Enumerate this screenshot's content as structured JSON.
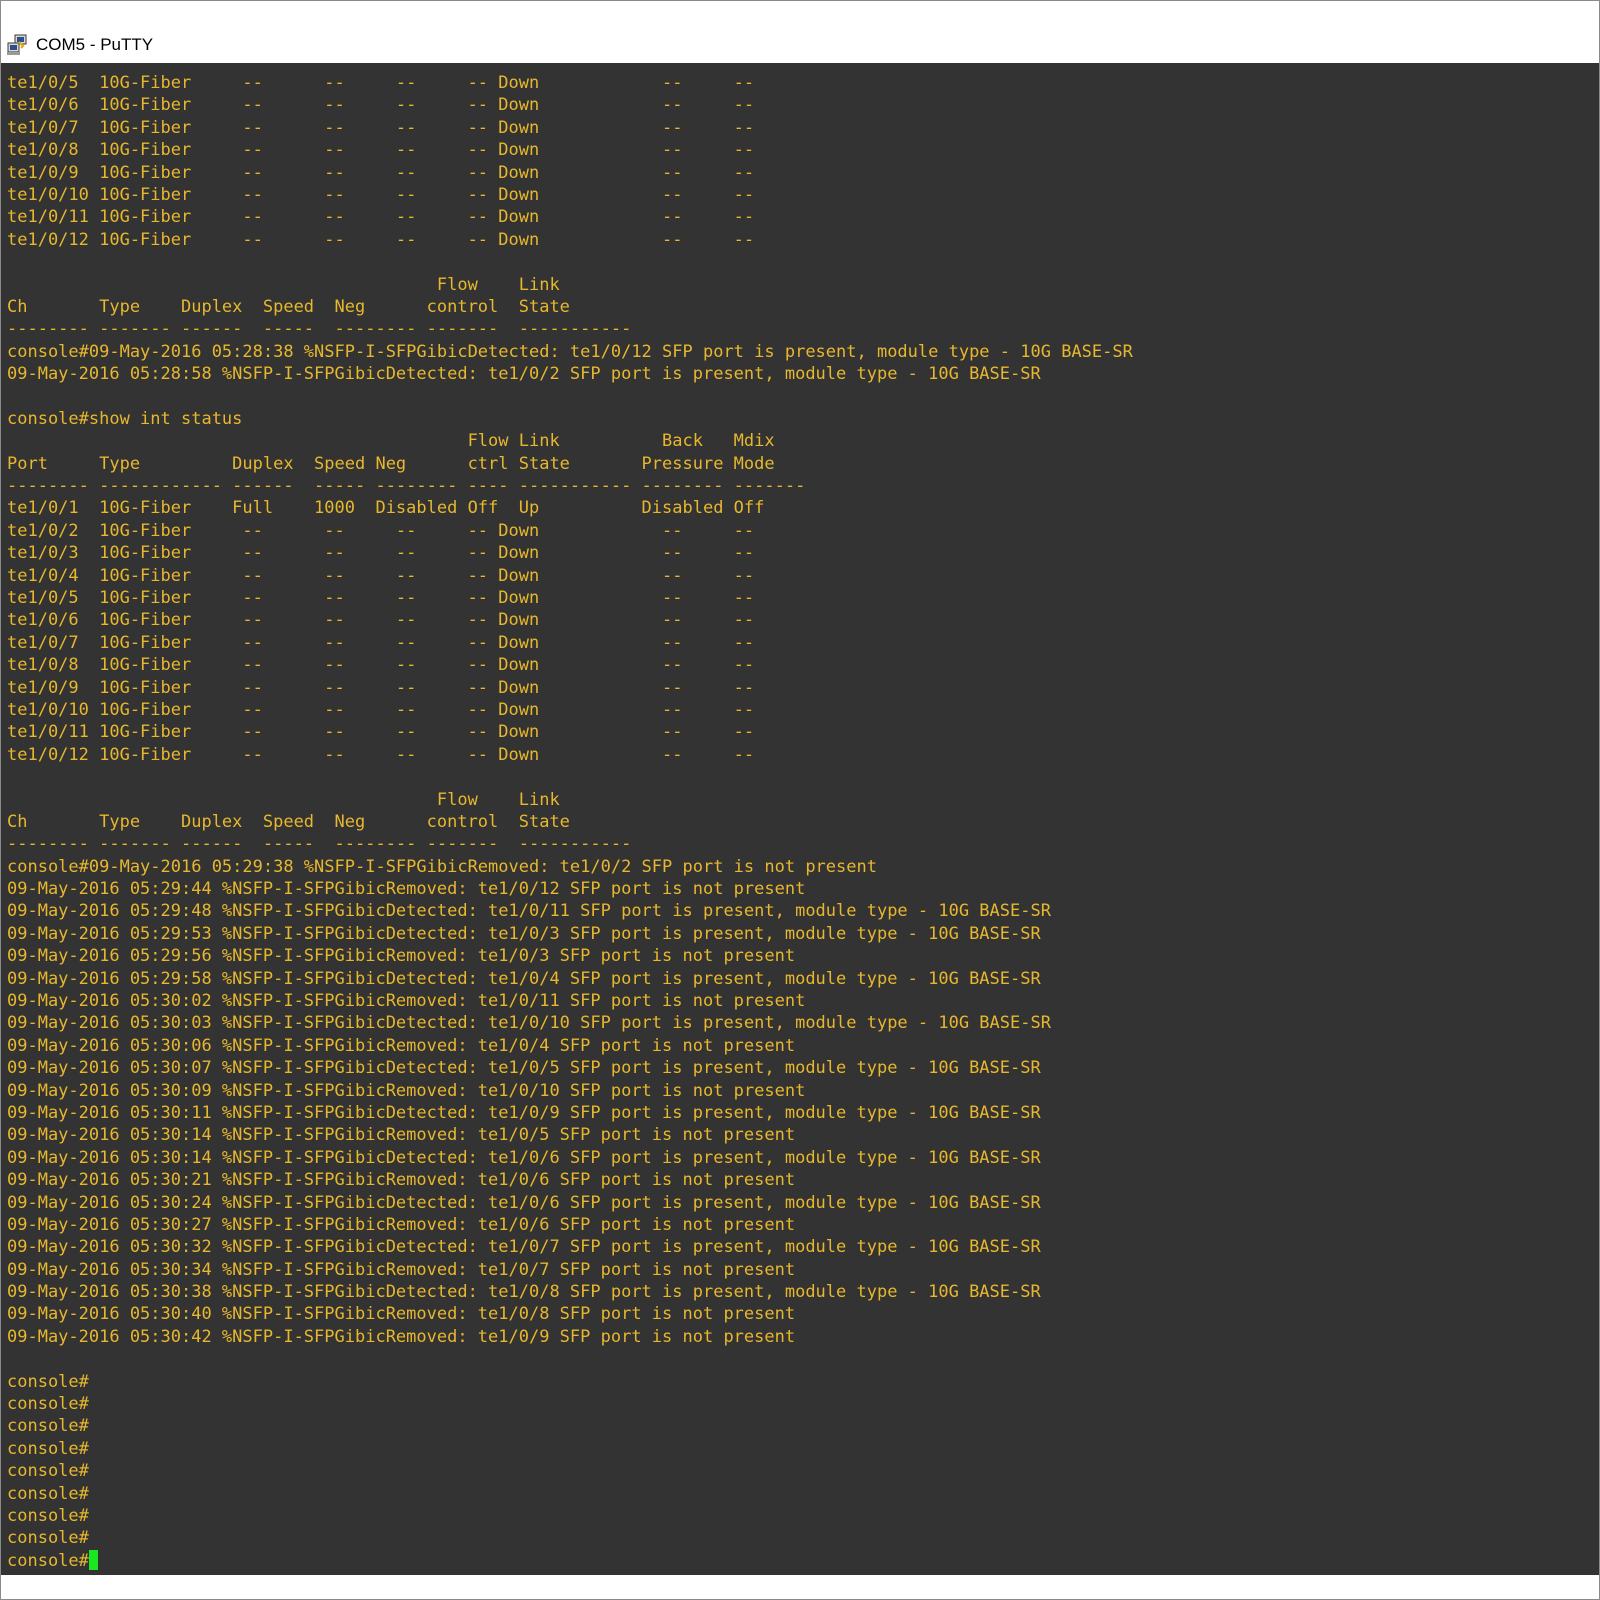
{
  "window": {
    "title": "COM5 - PuTTY",
    "app_icon": "putty-icon"
  },
  "colors": {
    "terminal_background": "#333333",
    "terminal_text": "#e7b72e",
    "cursor": "#19e81f",
    "titlebar": "#ffffff"
  },
  "terminal": {
    "lines": [
      "te1/0/5  10G-Fiber     --      --     --     -- Down            --     --",
      "te1/0/6  10G-Fiber     --      --     --     -- Down            --     --",
      "te1/0/7  10G-Fiber     --      --     --     -- Down            --     --",
      "te1/0/8  10G-Fiber     --      --     --     -- Down            --     --",
      "te1/0/9  10G-Fiber     --      --     --     -- Down            --     --",
      "te1/0/10 10G-Fiber     --      --     --     -- Down            --     --",
      "te1/0/11 10G-Fiber     --      --     --     -- Down            --     --",
      "te1/0/12 10G-Fiber     --      --     --     -- Down            --     --",
      "",
      "                                          Flow    Link",
      "Ch       Type    Duplex  Speed  Neg      control  State",
      "-------- ------- ------  -----  -------- -------  -----------",
      "console#09-May-2016 05:28:38 %NSFP-I-SFPGibicDetected: te1/0/12 SFP port is present, module type - 10G BASE-SR",
      "09-May-2016 05:28:58 %NSFP-I-SFPGibicDetected: te1/0/2 SFP port is present, module type - 10G BASE-SR",
      "",
      "console#show int status",
      "                                             Flow Link          Back   Mdix",
      "Port     Type         Duplex  Speed Neg      ctrl State       Pressure Mode",
      "-------- ------------ ------  ----- -------- ---- ----------- -------- -------",
      "te1/0/1  10G-Fiber    Full    1000  Disabled Off  Up          Disabled Off",
      "te1/0/2  10G-Fiber     --      --     --     -- Down            --     --",
      "te1/0/3  10G-Fiber     --      --     --     -- Down            --     --",
      "te1/0/4  10G-Fiber     --      --     --     -- Down            --     --",
      "te1/0/5  10G-Fiber     --      --     --     -- Down            --     --",
      "te1/0/6  10G-Fiber     --      --     --     -- Down            --     --",
      "te1/0/7  10G-Fiber     --      --     --     -- Down            --     --",
      "te1/0/8  10G-Fiber     --      --     --     -- Down            --     --",
      "te1/0/9  10G-Fiber     --      --     --     -- Down            --     --",
      "te1/0/10 10G-Fiber     --      --     --     -- Down            --     --",
      "te1/0/11 10G-Fiber     --      --     --     -- Down            --     --",
      "te1/0/12 10G-Fiber     --      --     --     -- Down            --     --",
      "",
      "                                          Flow    Link",
      "Ch       Type    Duplex  Speed  Neg      control  State",
      "-------- ------- ------  -----  -------- -------  -----------",
      "console#09-May-2016 05:29:38 %NSFP-I-SFPGibicRemoved: te1/0/2 SFP port is not present",
      "09-May-2016 05:29:44 %NSFP-I-SFPGibicRemoved: te1/0/12 SFP port is not present",
      "09-May-2016 05:29:48 %NSFP-I-SFPGibicDetected: te1/0/11 SFP port is present, module type - 10G BASE-SR",
      "09-May-2016 05:29:53 %NSFP-I-SFPGibicDetected: te1/0/3 SFP port is present, module type - 10G BASE-SR",
      "09-May-2016 05:29:56 %NSFP-I-SFPGibicRemoved: te1/0/3 SFP port is not present",
      "09-May-2016 05:29:58 %NSFP-I-SFPGibicDetected: te1/0/4 SFP port is present, module type - 10G BASE-SR",
      "09-May-2016 05:30:02 %NSFP-I-SFPGibicRemoved: te1/0/11 SFP port is not present",
      "09-May-2016 05:30:03 %NSFP-I-SFPGibicDetected: te1/0/10 SFP port is present, module type - 10G BASE-SR",
      "09-May-2016 05:30:06 %NSFP-I-SFPGibicRemoved: te1/0/4 SFP port is not present",
      "09-May-2016 05:30:07 %NSFP-I-SFPGibicDetected: te1/0/5 SFP port is present, module type - 10G BASE-SR",
      "09-May-2016 05:30:09 %NSFP-I-SFPGibicRemoved: te1/0/10 SFP port is not present",
      "09-May-2016 05:30:11 %NSFP-I-SFPGibicDetected: te1/0/9 SFP port is present, module type - 10G BASE-SR",
      "09-May-2016 05:30:14 %NSFP-I-SFPGibicRemoved: te1/0/5 SFP port is not present",
      "09-May-2016 05:30:14 %NSFP-I-SFPGibicDetected: te1/0/6 SFP port is present, module type - 10G BASE-SR",
      "09-May-2016 05:30:21 %NSFP-I-SFPGibicRemoved: te1/0/6 SFP port is not present",
      "09-May-2016 05:30:24 %NSFP-I-SFPGibicDetected: te1/0/6 SFP port is present, module type - 10G BASE-SR",
      "09-May-2016 05:30:27 %NSFP-I-SFPGibicRemoved: te1/0/6 SFP port is not present",
      "09-May-2016 05:30:32 %NSFP-I-SFPGibicDetected: te1/0/7 SFP port is present, module type - 10G BASE-SR",
      "09-May-2016 05:30:34 %NSFP-I-SFPGibicRemoved: te1/0/7 SFP port is not present",
      "09-May-2016 05:30:38 %NSFP-I-SFPGibicDetected: te1/0/8 SFP port is present, module type - 10G BASE-SR",
      "09-May-2016 05:30:40 %NSFP-I-SFPGibicRemoved: te1/0/8 SFP port is not present",
      "09-May-2016 05:30:42 %NSFP-I-SFPGibicRemoved: te1/0/9 SFP port is not present",
      "",
      "console#",
      "console#",
      "console#",
      "console#",
      "console#",
      "console#",
      "console#",
      "console#"
    ],
    "prompt": "console#"
  }
}
